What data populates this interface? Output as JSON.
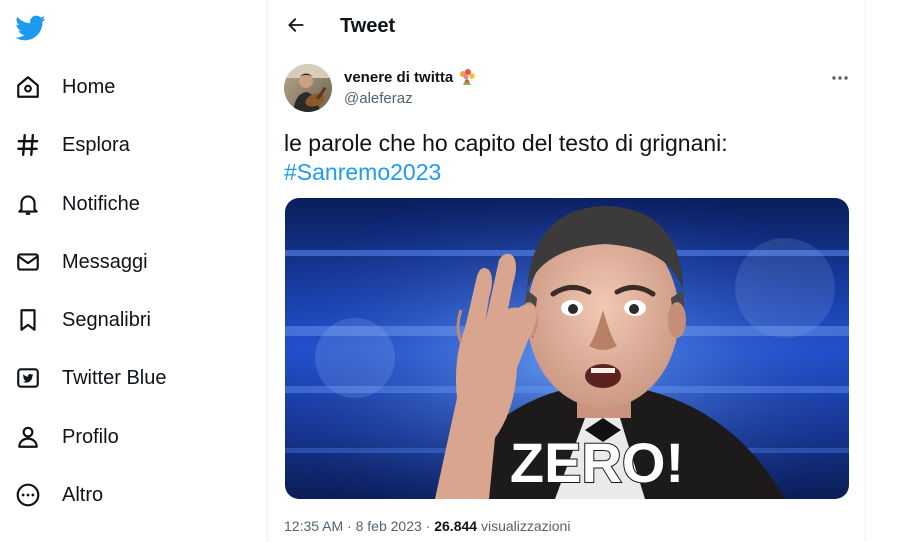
{
  "brand": {
    "logo_icon": "twitter-bird-icon",
    "color": "#1d9bf0"
  },
  "sidebar": {
    "items": [
      {
        "label": "Home",
        "icon": "home-icon"
      },
      {
        "label": "Esplora",
        "icon": "hashtag-icon"
      },
      {
        "label": "Notifiche",
        "icon": "bell-icon"
      },
      {
        "label": "Messaggi",
        "icon": "envelope-icon"
      },
      {
        "label": "Segnalibri",
        "icon": "bookmark-icon"
      },
      {
        "label": "Twitter Blue",
        "icon": "twitter-blue-icon"
      },
      {
        "label": "Profilo",
        "icon": "person-icon"
      },
      {
        "label": "Altro",
        "icon": "more-circle-icon"
      }
    ]
  },
  "header": {
    "title": "Tweet",
    "back_icon": "arrow-left-icon"
  },
  "tweet": {
    "author": {
      "display_name": "venere di twitta",
      "name_emoji": "bouquet-emoji-icon",
      "handle": "@aleferaz"
    },
    "text": "le parole che ho capito del testo di grignani:",
    "hashtag": "#Sanremo2023",
    "media": {
      "caption_text": "ZERO!"
    },
    "meta": {
      "time": "12:35 AM",
      "separator": "·",
      "date": "8 feb 2023",
      "views_count": "26.844",
      "views_label": "visualizzazioni"
    }
  },
  "colors": {
    "text_primary": "#0f1419",
    "text_secondary": "#536471",
    "link": "#1d9bf0",
    "divider": "#eff3f4"
  }
}
